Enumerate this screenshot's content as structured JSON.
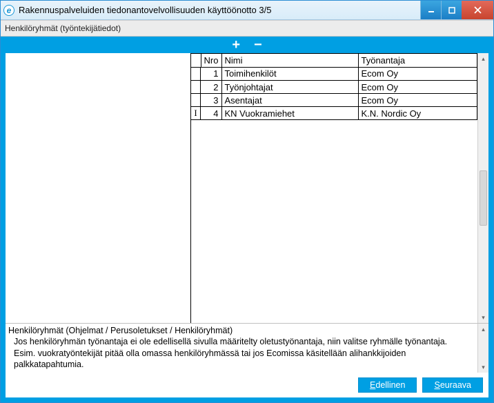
{
  "window": {
    "title": "Rakennuspalveluiden tiedonantovelvollisuuden käyttöönotto 3/5",
    "app_icon_letter": "e"
  },
  "panel_label": "Henkilöryhmät (työntekijätiedot)",
  "toolbar": {
    "add": "+",
    "remove": "−"
  },
  "grid": {
    "headers": {
      "nro": "Nro",
      "nimi": "Nimi",
      "tyonantaja": "Työnantaja"
    },
    "rows": [
      {
        "nro": "1",
        "nimi": "Toimihenkilöt",
        "tyonantaja": "Ecom Oy",
        "cursor": ""
      },
      {
        "nro": "2",
        "nimi": "Työnjohtajat",
        "tyonantaja": "Ecom Oy",
        "cursor": ""
      },
      {
        "nro": "3",
        "nimi": "Asentajat",
        "tyonantaja": "Ecom Oy",
        "cursor": ""
      },
      {
        "nro": "4",
        "nimi": "KN Vuokramiehet",
        "tyonantaja": "K.N. Nordic Oy",
        "cursor": "I"
      }
    ]
  },
  "info": {
    "title": "Henkilöryhmät (Ohjelmat / Perusoletukset / Henkilöryhmät)",
    "line1": "Jos henkilöryhmän työnantaja ei ole edellisellä sivulla määritelty oletustyönantaja, niin valitse ryhmälle työnantaja.",
    "line2": "Esim. vuokratyöntekijät pitää olla omassa henkilöryhmässä tai jos Ecomissa käsitellään alihankkijoiden palkkatapahtumia."
  },
  "buttons": {
    "prev_u": "E",
    "prev_rest": "dellinen",
    "next_u": "S",
    "next_rest": "euraava"
  }
}
